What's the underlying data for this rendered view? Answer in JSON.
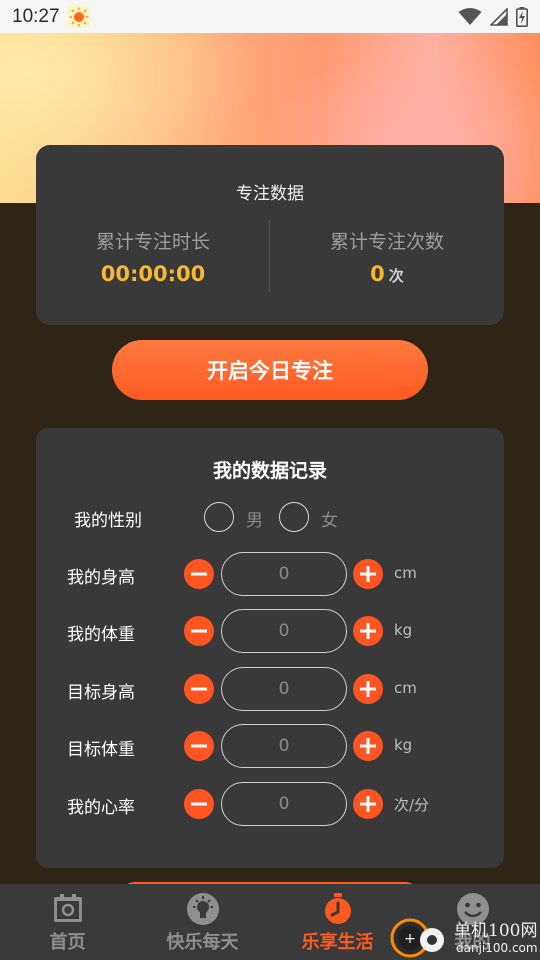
{
  "status_bar": {
    "time": "10:27",
    "icons": [
      "sun-notification-icon",
      "wifi-icon",
      "cell-signal-icon",
      "battery-charging-icon"
    ]
  },
  "focus_card": {
    "title": "专注数据",
    "total_duration_label": "累计专注时长",
    "total_duration_value": "00:00:00",
    "total_count_label": "累计专注次数",
    "total_count_value": "0",
    "total_count_unit": "次"
  },
  "start_button": {
    "label": "开启今日专注"
  },
  "records": {
    "title": "我的数据记录",
    "gender": {
      "label": "我的性别",
      "male": "男",
      "female": "女"
    },
    "rows": [
      {
        "label": "我的身高",
        "value": "0",
        "unit": "cm"
      },
      {
        "label": "我的体重",
        "value": "0",
        "unit": "kg"
      },
      {
        "label": "目标身高",
        "value": "0",
        "unit": "cm"
      },
      {
        "label": "目标体重",
        "value": "0",
        "unit": "kg"
      },
      {
        "label": "我的心率",
        "value": "0",
        "unit": "次/分"
      }
    ]
  },
  "bottom_nav": {
    "items": [
      {
        "label": "首页",
        "icon": "photo-frame-icon",
        "active": false
      },
      {
        "label": "快乐每天",
        "icon": "lightbulb-icon",
        "active": false
      },
      {
        "label": "乐享生活",
        "icon": "stopwatch-icon",
        "active": true
      },
      {
        "label": "我的",
        "icon": "smiley-face-icon",
        "active": false
      }
    ]
  },
  "watermark": {
    "text": "单机100网",
    "url_text": "danji100.com"
  },
  "colors": {
    "accent": "#ff5a22",
    "highlight": "#f7b733",
    "card_bg": "#393939",
    "page_bg": "#2f2516"
  }
}
